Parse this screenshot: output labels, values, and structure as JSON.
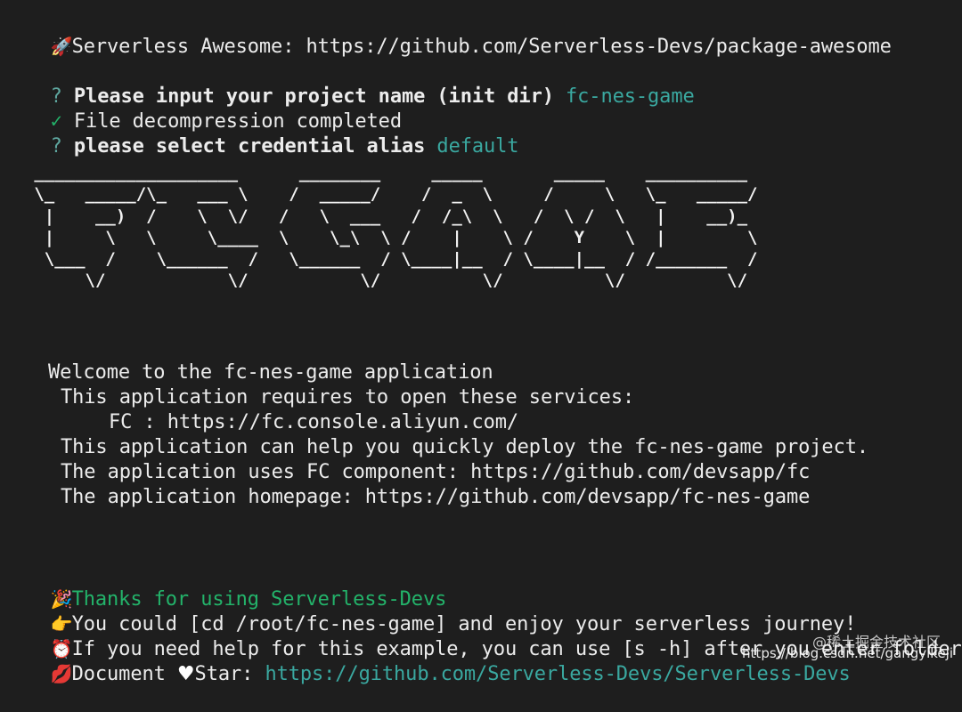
{
  "lines": {
    "awesome_icon": "rocket-icon",
    "awesome": "Serverless Awesome: https://github.com/Serverless-Devs/package-awesome",
    "prompt1_mark": "?",
    "prompt1_text": "Please input your project name (init dir)",
    "prompt1_value": "fc-nes-game",
    "done_mark": "✓",
    "done_text": "File decompression completed",
    "prompt2_mark": "?",
    "prompt2_text": "please select credential alias",
    "prompt2_value": "default"
  },
  "ascii_art": "   ____________________      ________     _____       _____    __________\n   \\_   _____/\\_   ___ \\    /  _____/    /  _  \\     /     \\   \\_   _____/\n    |    __)  /    \\  \\/   /   \\  ___   /  /_\\  \\   /  \\ /  \\   |    __)_\n    |     \\   \\     \\____  \\    \\_\\  \\ /    |    \\ /    Y    \\  |        \\\n    \\___  /    \\______  /   \\______  / \\____|__  / \\____|__  / /_______  /\n        \\/            \\/           \\/          \\/          \\/          \\/",
  "welcome": {
    "line1": "Welcome to the fc-nes-game application",
    "line2": "This application requires to open these services:",
    "line3": "FC : https://fc.console.aliyun.com/",
    "line4": "This application can help you quickly deploy the fc-nes-game project.",
    "line5": "The application uses FC component: https://github.com/devsapp/fc",
    "line6": "The application homepage: https://github.com/devsapp/fc-nes-game"
  },
  "footer": {
    "thanks_icon": "party-icon",
    "thanks": "Thanks for using Serverless-Devs",
    "cd_icon": "pointing-hand-icon",
    "cd": "You could [cd /root/fc-nes-game] and enjoy your serverless journey!",
    "help_icon": "clock-icon",
    "help": "If you need help for this example, you can use [s -h] after you enter folder.",
    "doc_icon": "lips-icon",
    "doc_label": "Document",
    "star_label": "Star:",
    "doc_link": "https://github.com/Serverless-Devs/Serverless-Devs"
  },
  "watermark": {
    "line1": "@稀土掘金技术社区",
    "line2": "https://blog.csdn.net/gangyikeji"
  },
  "colors": {
    "background": "#1e1e1e",
    "text": "#ececec",
    "accent_teal": "#3aa8a0",
    "check_green": "#23b36a"
  }
}
